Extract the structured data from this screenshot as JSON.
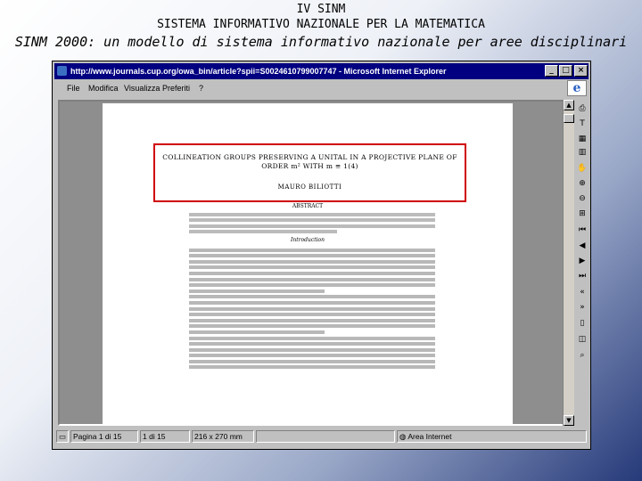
{
  "slide": {
    "title_line1": "IV SINM",
    "title_line2": "SISTEMA INFORMATIVO NAZIONALE PER LA MATEMATICA",
    "title_line3": "SINM 2000: un modello di sistema informativo nazionale per aree disciplinari"
  },
  "window": {
    "title": "http://www.journals.cup.org/owa_bin/article?spii=S0024610799007747 - Microsoft Internet Explorer",
    "minimize": "_",
    "maximize": "□",
    "close": "×"
  },
  "menu": [
    "File",
    "Modifica",
    "Visualizza",
    "Preferiti",
    "?"
  ],
  "paper": {
    "title": "COLLINEATION GROUPS PRESERVING A UNITAL IN A PROJECTIVE PLANE OF ORDER m² WITH m ≡ 1(4)",
    "author": "MAURO BILIOTTI",
    "abstract_heading": "ABSTRACT",
    "intro_heading": "Introduction"
  },
  "statusbar": {
    "page": "Pagina 1 di 15",
    "zoom": "1 di 15",
    "size": "216 x 270 mm",
    "zone": "Area Internet"
  },
  "icons": {
    "toolbar": [
      "print-icon",
      "select-text-icon",
      "table-icon",
      "columns-icon",
      "hand-icon",
      "zoom-in-icon",
      "zoom-out-icon",
      "fit-icon",
      "first-page-icon",
      "prev-page-icon",
      "next-page-icon",
      "last-page-icon",
      "back-icon",
      "forward-icon",
      "single-page-icon",
      "facing-pages-icon",
      "search-icon"
    ]
  },
  "colors": {
    "titlebar": "#000080",
    "highlight": "#d00000"
  }
}
